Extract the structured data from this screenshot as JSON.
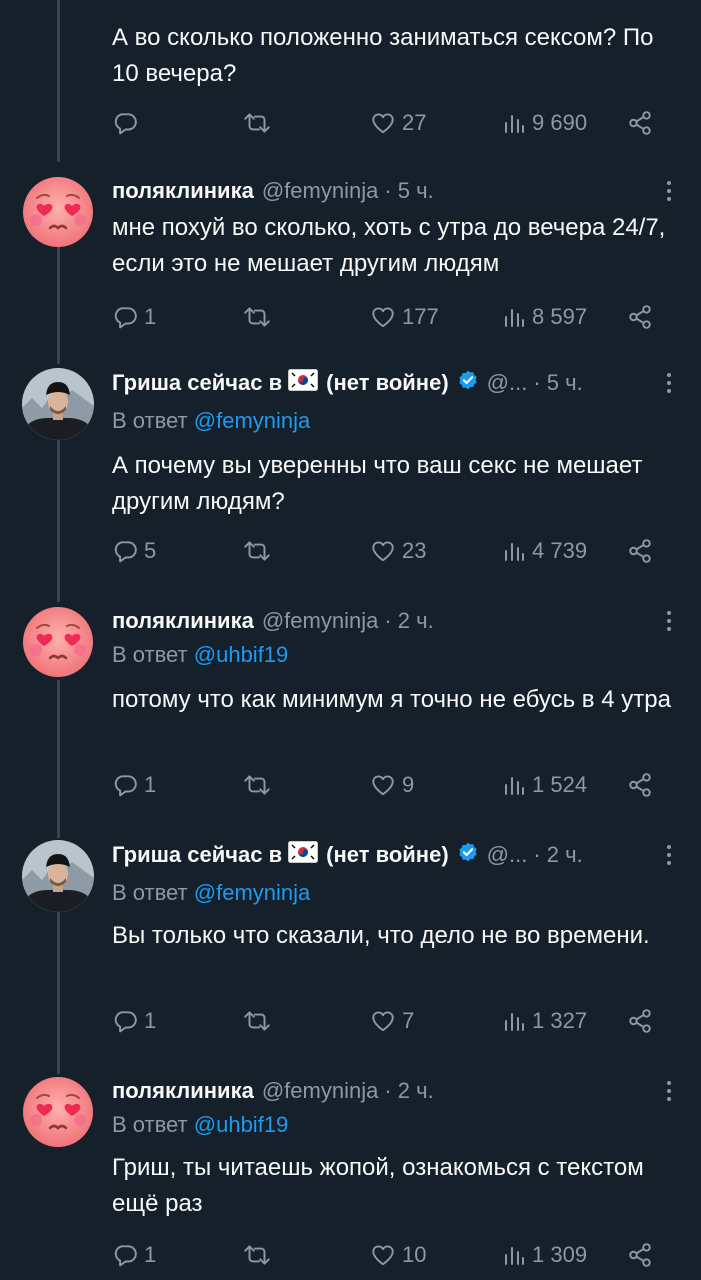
{
  "tweets": [
    {
      "text": "А во сколько положенно заниматься сексом? По 10 вечера?",
      "stats": {
        "replies": "",
        "retweets": "",
        "likes": "27",
        "views": "9 690"
      }
    },
    {
      "name": "поляклиника",
      "handle": "@femyninja",
      "time": "· 5 ч.",
      "text": "мне похуй во сколько, хоть с утра до вечера 24/7, если это не мешает другим людям",
      "stats": {
        "replies": "1",
        "retweets": "",
        "likes": "177",
        "views": "8 597"
      }
    },
    {
      "name_pre": "Гриша сейчас в",
      "name_post": "(нет войне)",
      "handle": "@...",
      "time": "· 5 ч.",
      "reply_prefix": "В ответ",
      "reply_to": "@femyninja",
      "text": "А почему вы уверенны что ваш секс не мешает другим людям?",
      "stats": {
        "replies": "5",
        "retweets": "",
        "likes": "23",
        "views": "4 739"
      }
    },
    {
      "name": "поляклиника",
      "handle": "@femyninja",
      "time": "· 2 ч.",
      "reply_prefix": "В ответ",
      "reply_to": "@uhbif19",
      "text": "потому что как минимум я точно не ебусь в 4 утра",
      "stats": {
        "replies": "1",
        "retweets": "",
        "likes": "9",
        "views": "1 524"
      }
    },
    {
      "name_pre": "Гриша сейчас в",
      "name_post": "(нет войне)",
      "handle": "@...",
      "time": "· 2 ч.",
      "reply_prefix": "В ответ",
      "reply_to": "@femyninja",
      "text": "Вы только что сказали, что дело не во времени.",
      "stats": {
        "replies": "1",
        "retweets": "",
        "likes": "7",
        "views": "1 327"
      }
    },
    {
      "name": "поляклиника",
      "handle": "@femyninja",
      "time": "· 2 ч.",
      "reply_prefix": "В ответ",
      "reply_to": "@uhbif19",
      "text": "Гриш, ты читаешь жопой, ознакомься с текстом ещё раз",
      "stats": {
        "replies": "1",
        "retweets": "",
        "likes": "10",
        "views": "1 309"
      }
    }
  ],
  "theme": {
    "background": "#15202b",
    "text": "#f7f9f9",
    "muted": "#8b98a5",
    "link": "#1d9bf0",
    "thread_line": "#38444d"
  },
  "icons": [
    "reply-icon",
    "retweet-icon",
    "heart-icon",
    "views-icon",
    "share-icon",
    "more-icon",
    "verified-badge-icon",
    "south-korea-flag-icon"
  ]
}
